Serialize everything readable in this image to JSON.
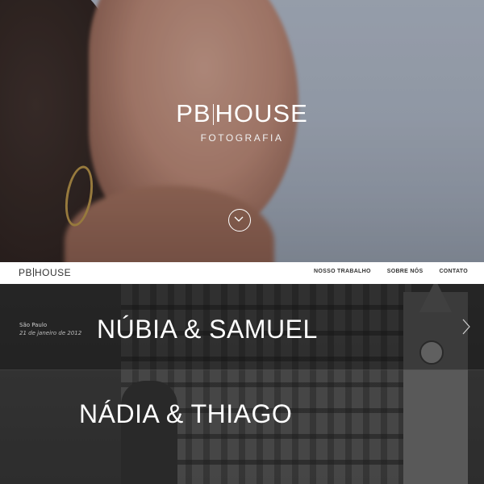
{
  "hero": {
    "title_left": "PB",
    "title_right": "HOUSE",
    "subtitle": "FOTOGRAFIA",
    "scroll_icon": "chevron-down-icon"
  },
  "nav": {
    "logo_left": "PB",
    "logo_right": "HOUSE",
    "items": [
      {
        "label": "NOSSO TRABALHO"
      },
      {
        "label": "SOBRE NÓS"
      },
      {
        "label": "CONTATO"
      }
    ]
  },
  "gallery": {
    "entries": [
      {
        "place": "São Paulo",
        "date": "21 de janeiro de 2012",
        "names": "NÚBIA & SAMUEL"
      },
      {
        "names": "NÁDIA & THIAGO"
      }
    ],
    "next_icon": "chevron-right-icon"
  },
  "colors": {
    "hero_overlay": "#a7afbc",
    "nav_bg": "#ffffff",
    "gallery_bg": "#333333",
    "text_light": "#ffffff"
  }
}
